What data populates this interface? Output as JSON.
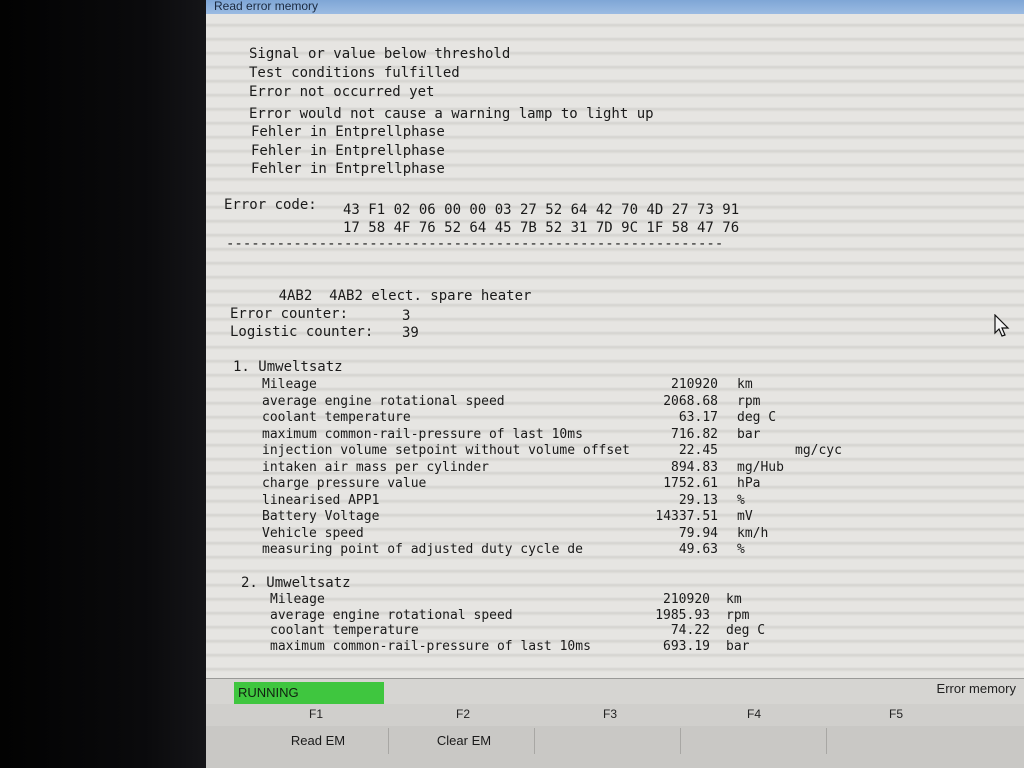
{
  "window": {
    "title": "Read error memory"
  },
  "status_lines": [
    "Signal or value below threshold",
    "Test conditions fulfilled",
    "Error not occurred yet",
    "Error would not cause a warning lamp to light up",
    "Fehler in Entprellphase",
    "Fehler in Entprellphase",
    "Fehler in Entprellphase"
  ],
  "error_code": {
    "label": "Error code:",
    "line1": "43 F1 02 06 00 00 03 27 52 64 42 70 4D 27 73 91",
    "line2": "17 58 4F 76 52 64 45 7B 52 31 7D 9C 1F 58 47 76"
  },
  "separator": "-----------------------------------------------------------",
  "fault": {
    "code": "4AB2",
    "text": "4AB2 elect. spare heater"
  },
  "counters": {
    "error_label": "Error counter:",
    "error_value": "3",
    "logistic_label": "Logistic counter:",
    "logistic_value": "39"
  },
  "env1": {
    "header": "1. Umweltsatz",
    "rows": [
      {
        "label": "Mileage",
        "value": "210920",
        "unit": "km"
      },
      {
        "label": "average engine rotational speed",
        "value": "2068.68",
        "unit": "rpm"
      },
      {
        "label": "coolant temperature",
        "value": "63.17",
        "unit": "deg C"
      },
      {
        "label": "maximum common-rail-pressure of last 10ms",
        "value": "716.82",
        "unit": "bar"
      },
      {
        "label": "injection volume setpoint without volume offset",
        "value": "22.45",
        "unit": "mg/cyc"
      },
      {
        "label": "intaken air mass per cylinder",
        "value": "894.83",
        "unit": "mg/Hub"
      },
      {
        "label": "charge pressure value",
        "value": "1752.61",
        "unit": "hPa"
      },
      {
        "label": "linearised APP1",
        "value": "29.13",
        "unit": "%"
      },
      {
        "label": "Battery Voltage",
        "value": "14337.51",
        "unit": "mV"
      },
      {
        "label": "Vehicle speed",
        "value": "79.94",
        "unit": "km/h"
      },
      {
        "label": "measuring point of adjusted duty cycle de",
        "value": "49.63",
        "unit": "%"
      }
    ]
  },
  "env2": {
    "header": "2. Umweltsatz",
    "rows": [
      {
        "label": "Mileage",
        "value": "210920",
        "unit": "km"
      },
      {
        "label": "average engine rotational speed",
        "value": "1985.93",
        "unit": "rpm"
      },
      {
        "label": "coolant temperature",
        "value": "74.22",
        "unit": "deg C"
      },
      {
        "label": "maximum common-rail-pressure of last 10ms",
        "value": "693.19",
        "unit": "bar"
      }
    ]
  },
  "status": {
    "running": "RUNNING",
    "mode": "Error memory"
  },
  "function_keys": {
    "keys": [
      "F1",
      "F2",
      "F3",
      "F4",
      "F5"
    ],
    "buttons": [
      "Read EM",
      "Clear EM",
      "",
      "",
      ""
    ]
  },
  "icons": {
    "cursor": "mouse-pointer-icon"
  }
}
